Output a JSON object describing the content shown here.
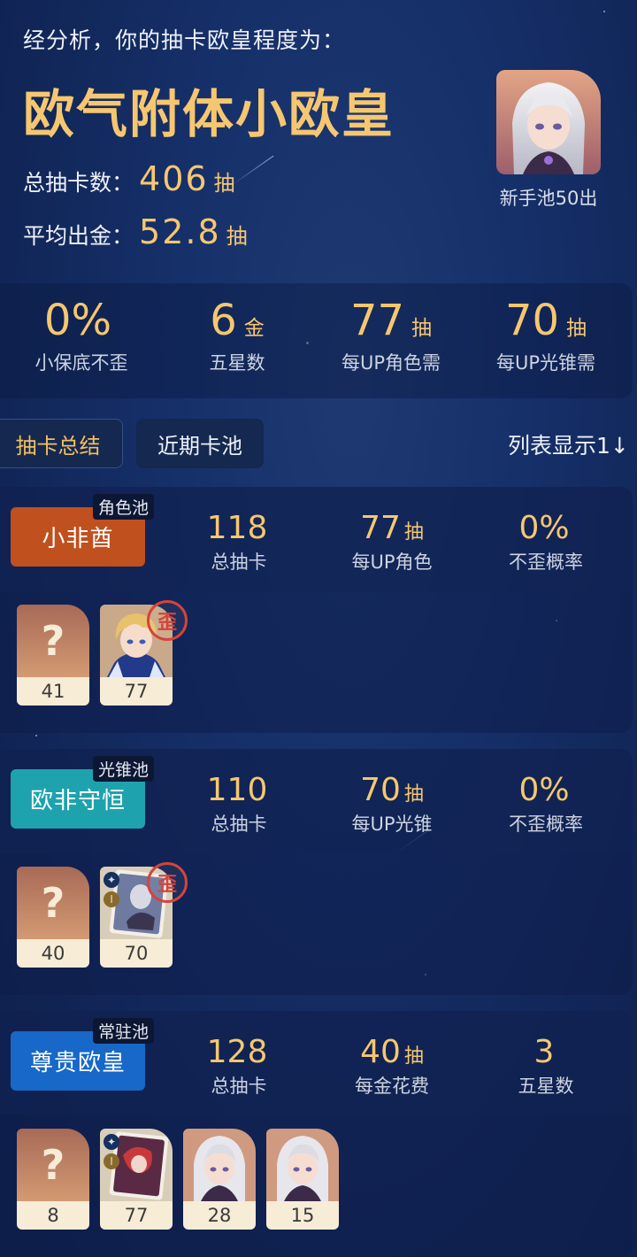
{
  "header": {
    "intro": "经分析，你的抽卡欧皇程度为：",
    "title": "欧气附体小欧皇",
    "total_label": "总抽卡数：",
    "total_value": "406",
    "total_unit": "抽",
    "avg_label": "平均出金：",
    "avg_value": "52.8",
    "avg_unit": "抽",
    "portrait_caption": "新手池50出"
  },
  "summary": [
    {
      "value": "0%",
      "unit": "",
      "label": "小保底不歪"
    },
    {
      "value": "6",
      "unit": "金",
      "label": "五星数"
    },
    {
      "value": "77",
      "unit": "抽",
      "label": "每UP角色需"
    },
    {
      "value": "70",
      "unit": "抽",
      "label": "每UP光锥需"
    }
  ],
  "tabs": {
    "active": "抽卡总结",
    "other": "近期卡池",
    "list_toggle": "列表显示1↓"
  },
  "pools": [
    {
      "type": "角色池",
      "name": "小非酋",
      "color": "#c0501e",
      "stats": [
        {
          "value": "118",
          "unit": "",
          "label": "总抽卡"
        },
        {
          "value": "77",
          "unit": "抽",
          "label": "每UP角色"
        },
        {
          "value": "0%",
          "unit": "",
          "label": "不歪概率"
        }
      ],
      "cards": [
        {
          "kind": "unknown",
          "icon": "question-mark",
          "count": "41"
        },
        {
          "kind": "character-blond",
          "icon": "blond-character-portrait",
          "count": "77",
          "badge": "歪"
        }
      ]
    },
    {
      "type": "光锥池",
      "name": "欧非守恒",
      "color": "#1ea3ae",
      "stats": [
        {
          "value": "110",
          "unit": "",
          "label": "总抽卡"
        },
        {
          "value": "70",
          "unit": "抽",
          "label": "每UP光锥"
        },
        {
          "value": "0%",
          "unit": "",
          "label": "不歪概率"
        }
      ],
      "cards": [
        {
          "kind": "unknown",
          "icon": "question-mark",
          "count": "40"
        },
        {
          "kind": "lightcone",
          "icon": "light-cone-card",
          "count": "70",
          "badge": "歪"
        }
      ]
    },
    {
      "type": "常驻池",
      "name": "尊贵欧皇",
      "color": "#1768c8",
      "stats": [
        {
          "value": "128",
          "unit": "",
          "label": "总抽卡"
        },
        {
          "value": "40",
          "unit": "抽",
          "label": "每金花费"
        },
        {
          "value": "3",
          "unit": "",
          "label": "五星数"
        }
      ],
      "cards": [
        {
          "kind": "unknown",
          "icon": "question-mark",
          "count": "8"
        },
        {
          "kind": "lightcone-red",
          "icon": "light-cone-card-red",
          "count": "77"
        },
        {
          "kind": "character-silver",
          "icon": "silver-hair-character-portrait",
          "count": "28"
        },
        {
          "kind": "character-silver",
          "icon": "silver-hair-character-portrait",
          "count": "15"
        }
      ]
    }
  ],
  "colors": {
    "gold": "#f6c770",
    "bg": "#16306a",
    "badge_red": "#d6433a"
  }
}
